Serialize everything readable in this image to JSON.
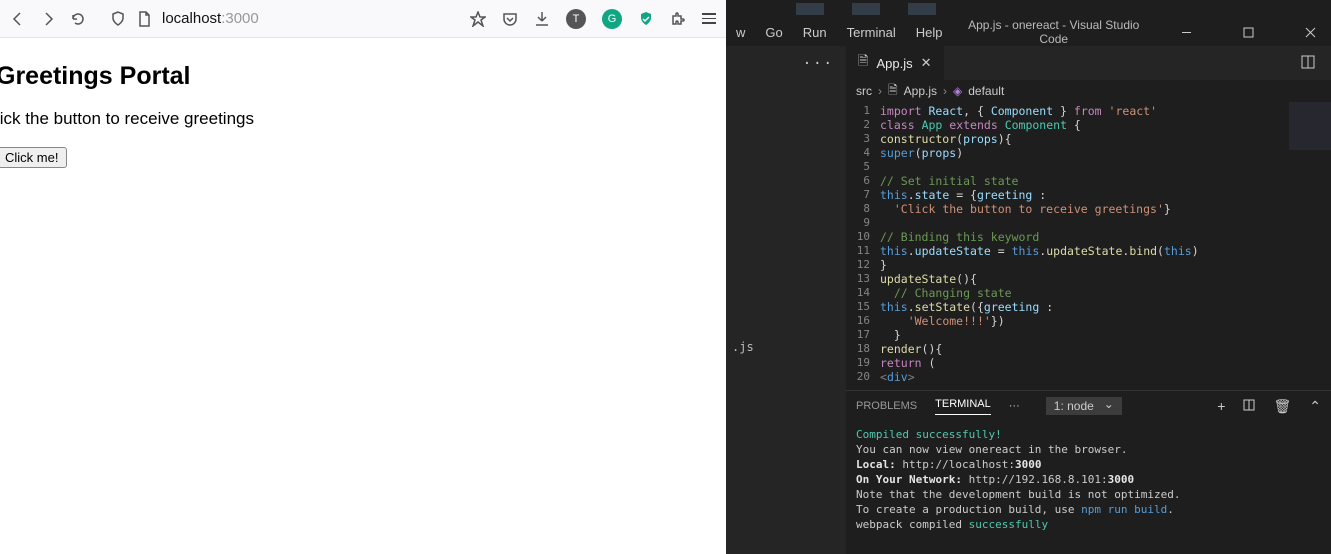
{
  "browser": {
    "url_host": "localhost",
    "url_port": ":3000"
  },
  "page": {
    "heading": "Greetings Portal",
    "paragraph": "lick the button to receive greetings",
    "button_label": "Click me!"
  },
  "vscode": {
    "menus": [
      "w",
      "Go",
      "Run",
      "Terminal",
      "Help"
    ],
    "window_title": "App.js - onereact - Visual Studio Code",
    "sidebar_file_label": ".js",
    "tab": {
      "label": "App.js"
    },
    "breadcrumbs": {
      "root": "src",
      "file": "App.js",
      "symbol": "default"
    },
    "code_lines": [
      {
        "n": 1,
        "html": "<span class='kw'>import</span> <span class='id'>React</span>, { <span class='id'>Component</span> } <span class='kw'>from</span> <span class='str'>'react'</span>"
      },
      {
        "n": 2,
        "html": "<span class='kw'>class</span> <span class='cls'>App</span> <span class='kw'>extends</span> <span class='cls'>Component</span> {"
      },
      {
        "n": 3,
        "html": "<span class='fn'>constructor</span>(<span class='id'>props</span>){"
      },
      {
        "n": 4,
        "html": "<span class='blue'>super</span>(<span class='id'>props</span>)"
      },
      {
        "n": 5,
        "html": ""
      },
      {
        "n": 6,
        "html": "<span class='cmt'>// Set initial state</span>"
      },
      {
        "n": 7,
        "html": "<span class='blue'>this</span>.<span class='id'>state</span> = {<span class='id'>greeting</span> :"
      },
      {
        "n": 8,
        "html": "  <span class='str'>'Click the button to receive greetings'</span>}"
      },
      {
        "n": 9,
        "html": ""
      },
      {
        "n": 10,
        "html": "<span class='cmt'>// Binding this keyword</span>"
      },
      {
        "n": 11,
        "html": "<span class='blue'>this</span>.<span class='id'>updateState</span> = <span class='blue'>this</span>.<span class='fn'>updateState</span>.<span class='fn'>bind</span>(<span class='blue'>this</span>)"
      },
      {
        "n": 12,
        "html": "}"
      },
      {
        "n": 13,
        "html": "<span class='fn'>updateState</span>(){"
      },
      {
        "n": 14,
        "html": "  <span class='cmt'>// Changing state</span>"
      },
      {
        "n": 15,
        "html": "<span class='blue'>this</span>.<span class='fn'>setState</span>({<span class='id'>greeting</span> :"
      },
      {
        "n": 16,
        "html": "    <span class='str'>'Welcome!!!'</span>})"
      },
      {
        "n": 17,
        "html": "  }"
      },
      {
        "n": 18,
        "html": "<span class='fn'>render</span>(){"
      },
      {
        "n": 19,
        "html": "<span class='kw'>return</span> ("
      },
      {
        "n": 20,
        "html": "<span class='tag'>&lt;</span><span class='blue'>div</span><span class='tag'>&gt;</span>"
      }
    ],
    "panel": {
      "tabs": [
        "PROBLEMS",
        "TERMINAL"
      ],
      "active_tab": "TERMINAL",
      "select": "1: node",
      "output": [
        {
          "cls": "t-green",
          "text": "Compiled successfully!"
        },
        {
          "cls": "",
          "text": ""
        },
        {
          "cls": "",
          "text": "You can now view onereact in the browser."
        },
        {
          "cls": "",
          "text": ""
        },
        {
          "cls": "",
          "html": "  <span class='t-bold'>Local:</span>            http://localhost:<span class='t-bold'>3000</span>"
        },
        {
          "cls": "",
          "html": "  <span class='t-bold'>On Your Network:</span>  http://192.168.8.101:<span class='t-bold'>3000</span>"
        },
        {
          "cls": "",
          "text": ""
        },
        {
          "cls": "",
          "text": "Note that the development build is not optimized."
        },
        {
          "cls": "",
          "html": "To create a production build, use <span class='t-blue'>npm run build</span>."
        },
        {
          "cls": "",
          "text": ""
        },
        {
          "cls": "",
          "html": "webpack compiled <span class='t-green'>successfully</span>"
        }
      ]
    }
  }
}
